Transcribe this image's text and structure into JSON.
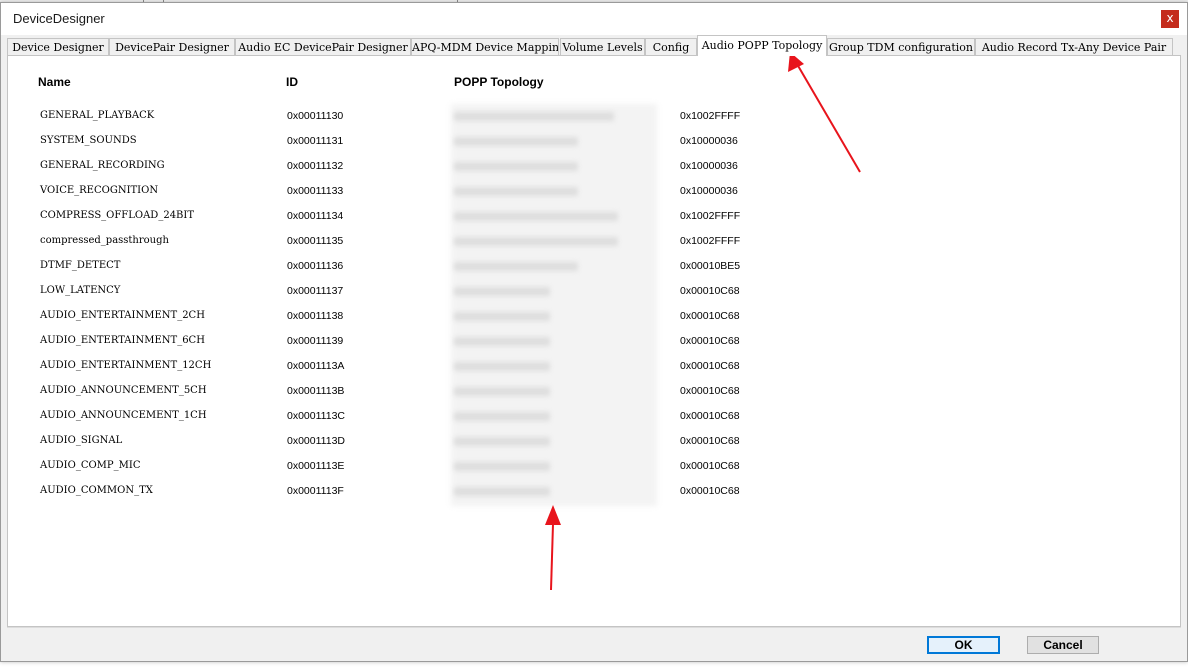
{
  "window": {
    "title": "DeviceDesigner",
    "close_glyph": "x"
  },
  "tabs": [
    {
      "label": "Device Designer",
      "active": false
    },
    {
      "label": "DevicePair Designer",
      "active": false
    },
    {
      "label": "Audio EC DevicePair Designer",
      "active": false
    },
    {
      "label": "APQ-MDM Device Mapping",
      "active": false
    },
    {
      "label": "Volume Levels",
      "active": false
    },
    {
      "label": "Config",
      "active": false
    },
    {
      "label": "Audio POPP Topology",
      "active": true
    },
    {
      "label": "Group TDM configuration",
      "active": false
    },
    {
      "label": "Audio Record Tx-Any Device Pair",
      "active": false
    }
  ],
  "table": {
    "columns": {
      "name": "Name",
      "id": "ID",
      "topology": "POPP Topology"
    },
    "rows": [
      {
        "name": "GENERAL_PLAYBACK",
        "id": "0x00011130",
        "extra": "0x1002FFFF"
      },
      {
        "name": "SYSTEM_SOUNDS",
        "id": "0x00011131",
        "extra": "0x10000036"
      },
      {
        "name": "GENERAL_RECORDING",
        "id": "0x00011132",
        "extra": "0x10000036"
      },
      {
        "name": "VOICE_RECOGNITION",
        "id": "0x00011133",
        "extra": "0x10000036"
      },
      {
        "name": "COMPRESS_OFFLOAD_24BIT",
        "id": "0x00011134",
        "extra": "0x1002FFFF"
      },
      {
        "name": "compressed_passthrough",
        "id": "0x00011135",
        "extra": "0x1002FFFF"
      },
      {
        "name": "DTMF_DETECT",
        "id": "0x00011136",
        "extra": "0x00010BE5"
      },
      {
        "name": "LOW_LATENCY",
        "id": "0x00011137",
        "extra": "0x00010C68"
      },
      {
        "name": "AUDIO_ENTERTAINMENT_2CH",
        "id": "0x00011138",
        "extra": "0x00010C68"
      },
      {
        "name": "AUDIO_ENTERTAINMENT_6CH",
        "id": "0x00011139",
        "extra": "0x00010C68"
      },
      {
        "name": "AUDIO_ENTERTAINMENT_12CH",
        "id": "0x0001113A",
        "extra": "0x00010C68"
      },
      {
        "name": "AUDIO_ANNOUNCEMENT_5CH",
        "id": "0x0001113B",
        "extra": "0x00010C68"
      },
      {
        "name": "AUDIO_ANNOUNCEMENT_1CH",
        "id": "0x0001113C",
        "extra": "0x00010C68"
      },
      {
        "name": "AUDIO_SIGNAL",
        "id": "0x0001113D",
        "extra": "0x00010C68"
      },
      {
        "name": "AUDIO_COMP_MIC",
        "id": "0x0001113E",
        "extra": "0x00010C68"
      },
      {
        "name": "AUDIO_COMMON_TX",
        "id": "0x0001113F",
        "extra": "0x00010C68"
      }
    ]
  },
  "buttons": {
    "ok": "OK",
    "cancel": "Cancel"
  },
  "colors": {
    "annotation_arrow": "#e8141c",
    "close_button": "#c42b1c",
    "ok_border": "#0078d7"
  }
}
